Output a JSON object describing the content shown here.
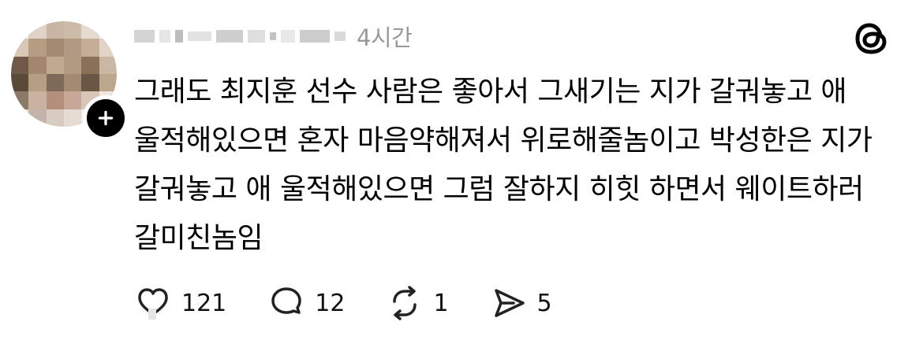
{
  "post": {
    "author": {
      "username": "",
      "avatar": "pixelated-avatar"
    },
    "timestamp": "4시간",
    "body": "그래도 최지훈 선수 사람은 좋아서 그새기는 지가 갈궈놓고 애 울적해있으면 혼자 마음약해져서 위로해줄놈이고 박성한은 지가 갈궈놓고 애 울적해있으면 그럼 잘하지 히힛 하면서 웨이트하러 갈미친놈임"
  },
  "actions": {
    "like": {
      "icon": "heart-icon",
      "count": "121"
    },
    "reply": {
      "icon": "comment-icon",
      "count": "12"
    },
    "repost": {
      "icon": "repost-icon",
      "count": "1"
    },
    "share": {
      "icon": "send-icon",
      "count": "5"
    }
  },
  "brand": {
    "logo": "threads-logo-icon",
    "color": "#000000"
  },
  "colors": {
    "muted": "#999999",
    "text": "#000000"
  }
}
